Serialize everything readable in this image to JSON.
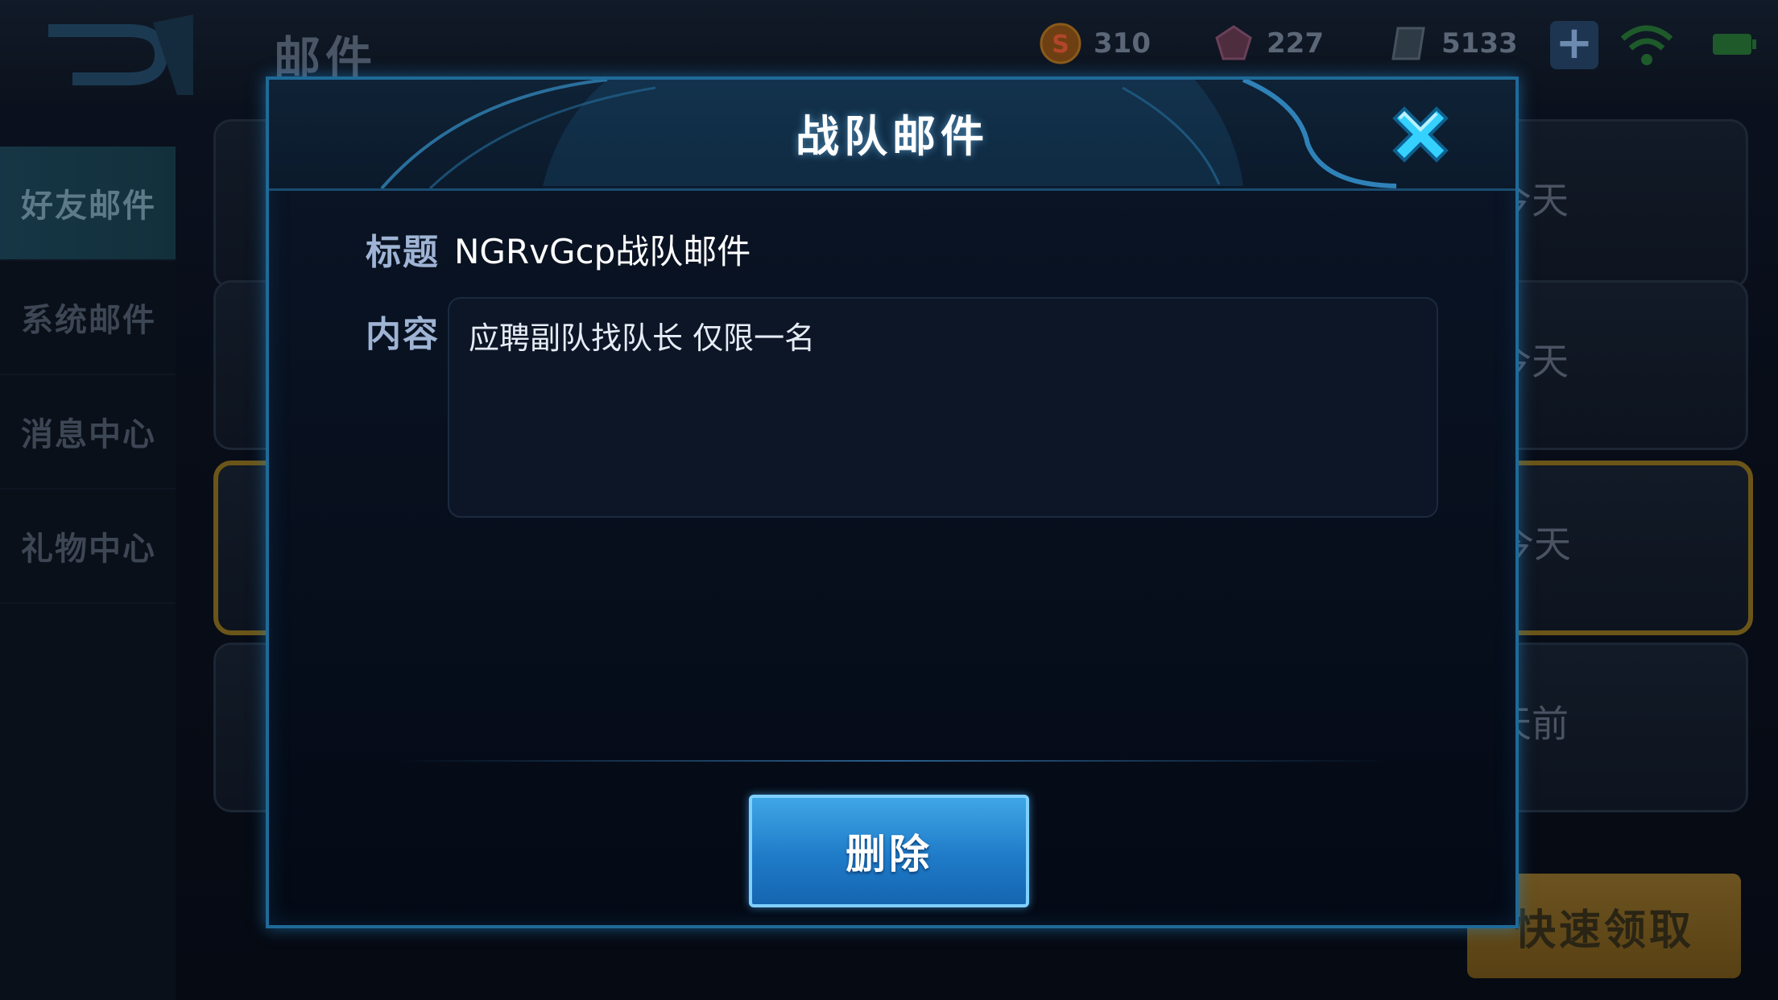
{
  "topbar": {
    "page_title": "邮件",
    "gold": "310",
    "gems": "227",
    "tickets": "5133"
  },
  "sidebar": {
    "items": [
      {
        "label": "好友邮件",
        "active": true
      },
      {
        "label": "系统邮件",
        "active": false
      },
      {
        "label": "消息中心",
        "active": false
      },
      {
        "label": "礼物中心",
        "active": false
      }
    ]
  },
  "mail_list": {
    "times": [
      "今天",
      "今天",
      "今天",
      "天前"
    ],
    "quick_claim_label": "快速领取"
  },
  "modal": {
    "title": "战队邮件",
    "subject_label": "标题",
    "subject_value": "NGRvGcp战队邮件",
    "content_label": "内容",
    "content_value": "应聘副队找队长 仅限一名",
    "delete_label": "删除"
  },
  "colors": {
    "accent": "#1f6a98",
    "button_blue": "#1f7bc8",
    "close_cyan": "#35d2ff"
  },
  "icons": [
    "back-icon",
    "gold-coin-icon",
    "gem-icon",
    "ticket-icon",
    "plus-icon",
    "wifi-icon",
    "battery-icon",
    "close-icon"
  ]
}
